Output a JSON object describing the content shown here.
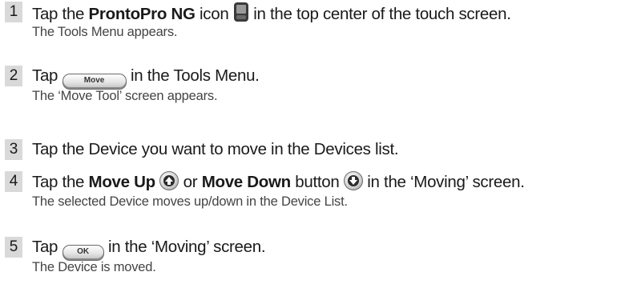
{
  "steps": [
    {
      "number": "1",
      "text_parts": [
        "Tap the ",
        "ProntoPro NG",
        " icon ",
        " in the top center of the touch screen."
      ],
      "result": "The Tools Menu appears."
    },
    {
      "number": "2",
      "text_parts": [
        "Tap ",
        " in the Tools Menu."
      ],
      "button_label": "Move",
      "result": "The ‘Move Tool’ screen appears."
    },
    {
      "number": "3",
      "text": "Tap the Device you want to move in the Devices list."
    },
    {
      "number": "4",
      "text_parts": [
        "Tap the ",
        "Move Up",
        " or ",
        "Move Down",
        " button ",
        " in the ‘Moving’ screen."
      ],
      "result": "The selected Device moves up/down in the Device List."
    },
    {
      "number": "5",
      "text_parts": [
        "Tap ",
        " in the ‘Moving’ screen."
      ],
      "button_label": "OK",
      "result": "The Device is moved."
    }
  ],
  "icons": {
    "step1": "prontopro-ng-device-icon",
    "step4_up": "move-up-arrow-icon",
    "step4_down": "move-down-arrow-icon"
  }
}
